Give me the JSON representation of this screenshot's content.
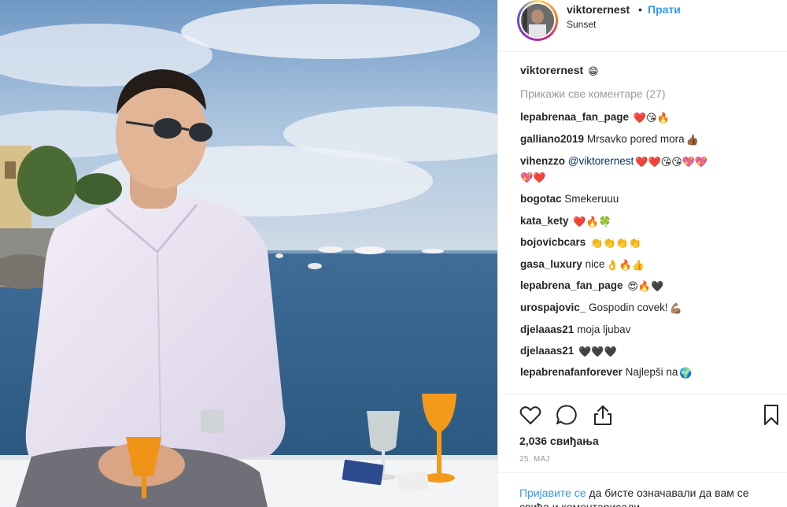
{
  "post": {
    "username": "viktorernest",
    "dot": "•",
    "follow_label": "Прати",
    "location": "Sunset"
  },
  "caption": {
    "username": "viktorernest",
    "emoji": "😁"
  },
  "view_all_comments": "Прикажи све коментаре (27)",
  "comments": [
    {
      "user": "lepabrenaa_fan_page",
      "text": "",
      "emoji": "❤️😘🔥"
    },
    {
      "user": "galliano2019",
      "text": "Mrsavko pored mora",
      "emoji": "👍🏾"
    },
    {
      "user": "vihenzzo",
      "mention": "@viktorernest",
      "text": "",
      "emoji": "❤️❤️😘😘💖💖",
      "emoji2": "💖❤️"
    },
    {
      "user": "bogotac",
      "text": "Smekeruuu",
      "emoji": ""
    },
    {
      "user": "kata_kety",
      "text": "",
      "emoji": "❤️🔥🍀"
    },
    {
      "user": "bojovicbcars",
      "text": "",
      "emoji": "👏👏👏👏"
    },
    {
      "user": "gasa_luxury",
      "text": "nice",
      "emoji": "👌🔥👍"
    },
    {
      "user": "lepabrena_fan_page",
      "text": "",
      "emoji": "😍🔥🖤"
    },
    {
      "user": "urospajovic_",
      "text": "Gospodin covek!",
      "emoji": "💪🏽"
    },
    {
      "user": "djelaaas21",
      "text": "moja ljubav",
      "emoji": ""
    },
    {
      "user": "djelaaas21",
      "text": "",
      "emoji": "🖤🖤🖤"
    },
    {
      "user": "lepabrenafanforever",
      "text": "Najlepši na",
      "emoji": "🌍"
    }
  ],
  "icons": {
    "like": "heart-icon",
    "comment": "comment-icon",
    "share": "share-icon",
    "save": "bookmark-icon"
  },
  "likes": "2,036 свиђања",
  "date": "25. МАЈ",
  "login_prompt": {
    "link": "Пријавите се",
    "text": " да бисте означавали да вам се свиђа и коментарисали."
  }
}
